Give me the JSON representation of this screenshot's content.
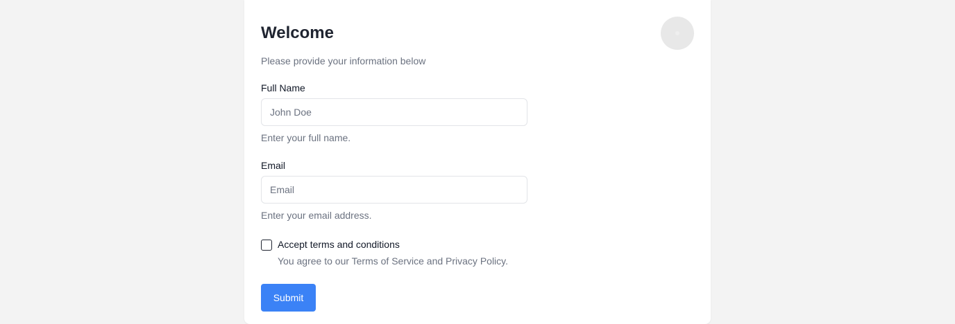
{
  "form": {
    "title": "Welcome",
    "subtitle": "Please provide your information below",
    "full_name": {
      "label": "Full Name",
      "placeholder": "John Doe",
      "value": "",
      "help": "Enter your full name."
    },
    "email": {
      "label": "Email",
      "placeholder": "Email",
      "value": "",
      "help": "Enter your email address."
    },
    "terms": {
      "label": "Accept terms and conditions",
      "help": "You agree to our Terms of Service and Privacy Policy.",
      "checked": false
    },
    "submit_label": "Submit"
  },
  "colors": {
    "background": "#f3f3f3",
    "card": "#ffffff",
    "accent": "#3b82f6",
    "avatar": "#e8e8e8"
  }
}
